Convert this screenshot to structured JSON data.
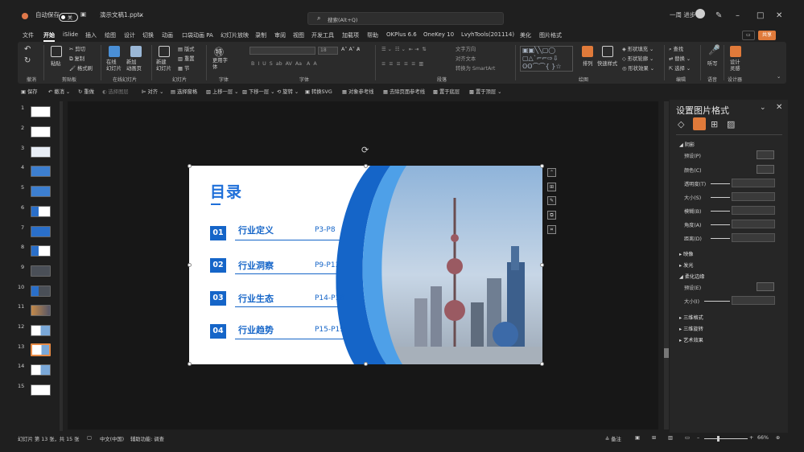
{
  "title_bar": {
    "autosave_label": "自动保存",
    "autosave_state": "关",
    "file_name": "演示文稿1.pptx",
    "search_placeholder": "搜索(Alt+Q)",
    "user_name": "一周 进步"
  },
  "menu": {
    "items": [
      "文件",
      "开始",
      "iSlide",
      "插入",
      "绘图",
      "设计",
      "切换",
      "动画",
      "口袋动画 PA",
      "幻灯片放映",
      "录制",
      "审阅",
      "视图",
      "开发工具",
      "加载项",
      "帮助",
      "OKPlus 6.6",
      "OneKey 10",
      "LvyhTools(201114)",
      "美化",
      "图片格式"
    ],
    "share_label": "共享"
  },
  "ribbon": {
    "clipboard": {
      "paste": "粘贴",
      "cut": "剪切",
      "copy": "复制",
      "format_painter": "格式刷",
      "group": "剪贴板"
    },
    "slides_online": {
      "online": "在线\n幻灯片",
      "new_anim": "新加\n动画页",
      "group": "在线幻灯片"
    },
    "slides": {
      "new": "新建\n幻灯片",
      "layout": "版式",
      "reset": "重置",
      "section": "节",
      "group": "幻灯片"
    },
    "font": {
      "size": "18",
      "group": "字体",
      "theme_font": "更用字\n体"
    },
    "paragraph": {
      "text_dir": "文字方向",
      "align": "对齐文本",
      "smartart": "转换为 SmartArt",
      "group": "段落"
    },
    "drawing": {
      "arrange": "排列",
      "quick_style": "快速样式",
      "fill": "形状填充",
      "outline": "形状轮廓",
      "effect": "形状效果",
      "group": "绘图"
    },
    "editing": {
      "find": "查找",
      "replace": "替换",
      "select": "选择",
      "group": "编辑"
    },
    "voice": {
      "dictate": "听写",
      "group": "语音"
    },
    "designer": {
      "ideas": "设计\n灵感",
      "group": "设计器"
    },
    "undo_group": "撤消"
  },
  "qat": {
    "items": [
      "保存",
      "撤消",
      "重做",
      "选择图层",
      "对齐",
      "选择窗格",
      "上移一层",
      "下移一层",
      "旋转",
      "转换SVG",
      "对象参考线",
      "去除页面参考线",
      "置于底层",
      "置于顶层"
    ]
  },
  "thumbnails": {
    "numbers": [
      "1",
      "2",
      "3",
      "4",
      "5",
      "6",
      "7",
      "8",
      "9",
      "10",
      "11",
      "12",
      "13",
      "14",
      "15"
    ],
    "selected": "13"
  },
  "slide": {
    "title": "目录",
    "items": [
      {
        "num": "01",
        "text": "行业定义",
        "pages": "P3-P8"
      },
      {
        "num": "02",
        "text": "行业洞察",
        "pages": "P9-P13"
      },
      {
        "num": "03",
        "text": "行业生态",
        "pages": "P14-P18"
      },
      {
        "num": "04",
        "text": "行业趋势",
        "pages": "P15-P19"
      }
    ]
  },
  "pane": {
    "title": "设置图片格式",
    "shadow": "阴影",
    "preset": "预设(P)",
    "color": "颜色(C)",
    "transparency": "透明度(T)",
    "size": "大小(S)",
    "blur": "模糊(B)",
    "angle": "角度(A)",
    "distance": "距离(D)",
    "reflection": "映像",
    "glow": "发光",
    "soft_edges": "柔化边缘",
    "soft_preset": "预设(E)",
    "soft_size": "大小(I)",
    "threed_format": "三维格式",
    "threed_rotation": "三维旋转",
    "artistic": "艺术效果"
  },
  "status": {
    "slide_info": "幻灯片 第 13 张，共 15 张",
    "lang": "中文(中国)",
    "accessibility": "辅助功能: 调查",
    "notes": "备注",
    "zoom": "66%"
  },
  "colors": {
    "accent": "#1565c8",
    "share": "#e07a3a",
    "selected_thumb": "#e68a45"
  }
}
